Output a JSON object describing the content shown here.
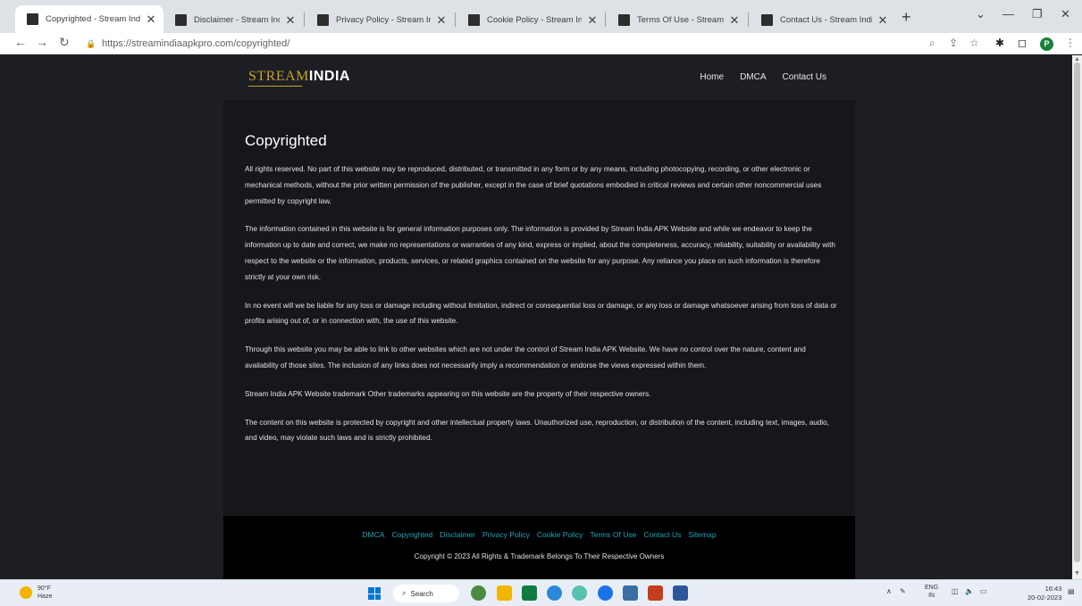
{
  "browser": {
    "tabs": [
      {
        "title": "Copyrighted - Stream India",
        "active": true
      },
      {
        "title": "Disclaimer - Stream India A",
        "active": false
      },
      {
        "title": "Privacy Policy - Stream Indi",
        "active": false
      },
      {
        "title": "Cookie Policy - Stream Indi",
        "active": false
      },
      {
        "title": "Terms Of Use - Stream Indi",
        "active": false
      },
      {
        "title": "Contact Us - Stream India A",
        "active": false
      }
    ],
    "url": "https://streamindiaapkpro.com/copyrighted/",
    "profile_initial": "P"
  },
  "site": {
    "logo_stream": "STREAM",
    "logo_india": "INDIA",
    "nav": [
      "Home",
      "DMCA",
      "Contact Us"
    ],
    "page_title": "Copyrighted",
    "paragraphs": [
      "All rights reserved. No part of this website may be reproduced, distributed, or transmitted in any form or by any means, including photocopying, recording, or other electronic or mechanical methods, without the prior written permission of the publisher, except in the case of brief quotations embodied in critical reviews and certain other noncommercial uses permitted by copyright law.",
      "The information contained in this website is for general information purposes only. The information is provided by Stream India APK Website and while we endeavor to keep the information up to date and correct, we make no representations or warranties of any kind, express or implied, about the completeness, accuracy, reliability, suitability or availability with respect to the website or the information, products, services, or related graphics contained on the website for any purpose. Any reliance you place on such information is therefore strictly at your own risk.",
      "In no event will we be liable for any loss or damage including without limitation, indirect or consequential loss or damage, or any loss or damage whatsoever arising from loss of data or profits arising out of, or in connection with, the use of this website.",
      "Through this website you may be able to link to other websites which are not under the control of Stream India APK Website. We have no control over the nature, content and availability of those sites. The inclusion of any links does not necessarily imply a recommendation or endorse the views expressed within them.",
      "Stream India APK Website trademark Other trademarks appearing on this website are the property of their respective owners.",
      "The content on this website is protected by copyright and other intellectual property laws. Unauthorized use, reproduction, or distribution of the content, including text, images, audio, and video, may violate such laws and is strictly prohibited."
    ],
    "footer_links": [
      "DMCA",
      "Copyrighted",
      "Disclaimer",
      "Privacy Policy",
      "Cookie Policy",
      "Terms Of Use",
      "Contact Us",
      "Sitemap"
    ],
    "copyright": "Copyright © 2023 All Rights & Trademark Belongs To Their Respective Owners"
  },
  "taskbar": {
    "temperature": "90°F",
    "condition": "Haze",
    "search_label": "Search",
    "lang_top": "ENG",
    "lang_bottom": "IN",
    "time": "16:43",
    "date": "20-02-2023"
  },
  "colors": {
    "accent_gold": "#c9a227",
    "footer_link": "#1fa3b8",
    "page_bg": "#15171b"
  }
}
